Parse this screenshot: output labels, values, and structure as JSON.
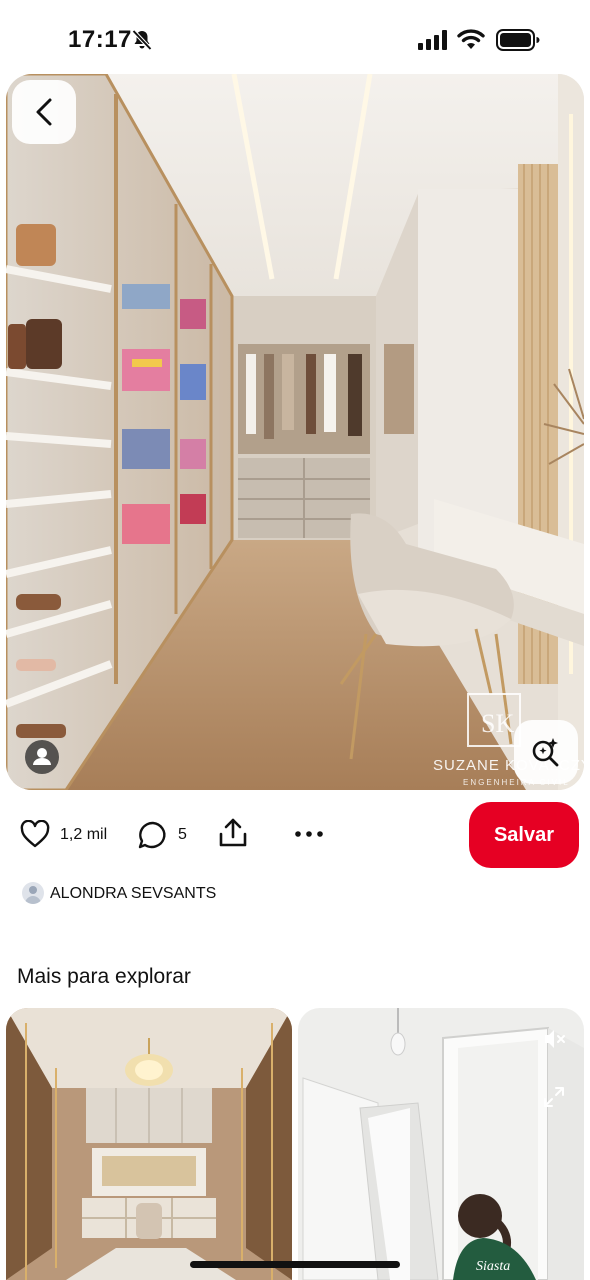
{
  "status_bar": {
    "time": "17:17",
    "icons": [
      "bell-slash-icon",
      "cellular-signal-icon",
      "wifi-icon",
      "battery-icon"
    ]
  },
  "pin": {
    "image": "walk-in closet interior",
    "watermark": {
      "name": "SUZANE KOVALCZYK",
      "subtitle": "ENGENHEIRA CIVIL"
    },
    "likes": "1,2 mil",
    "comments": "5",
    "save_label": "Salvar",
    "creator": "ALONDRA SEVSANTS"
  },
  "explore": {
    "title": "Mais para explorar",
    "cards": [
      {
        "image": "closet with chandelier and vanity"
      },
      {
        "image": "person assembling white wardrobe"
      }
    ]
  },
  "colors": {
    "accent": "#e60023",
    "text": "#111111"
  }
}
